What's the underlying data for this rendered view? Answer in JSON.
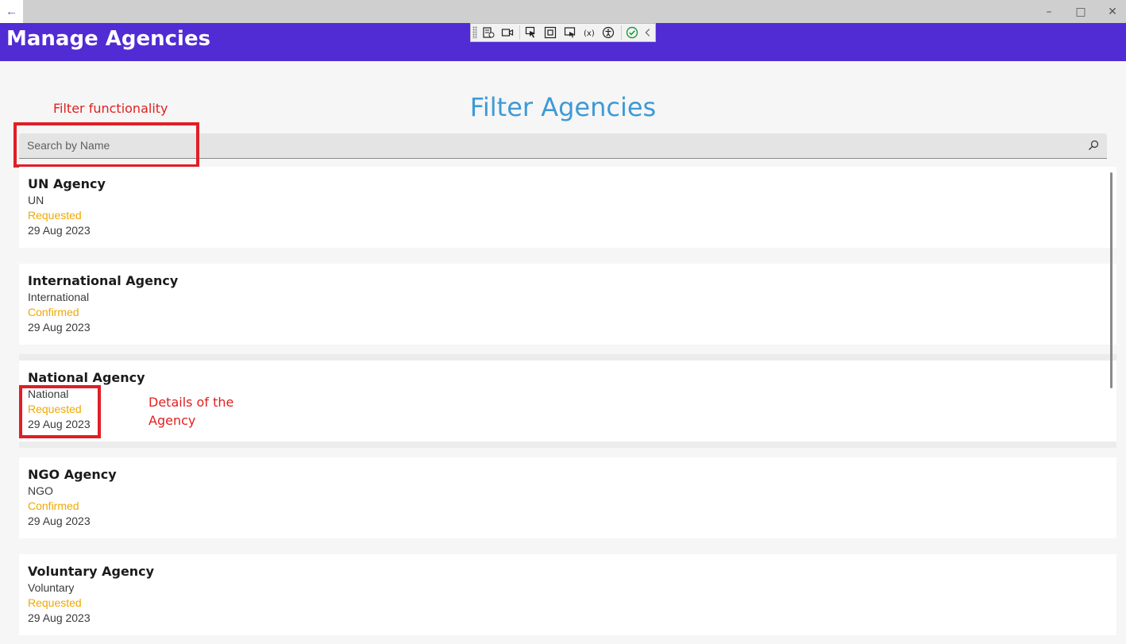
{
  "window": {
    "back_icon": "arrow-left-icon",
    "controls": [
      "minimize-icon",
      "maximize-icon",
      "close-icon"
    ]
  },
  "header": {
    "title": "Manage Agencies",
    "accent_color": "#512bd4"
  },
  "debug_toolbar": {
    "icons": [
      "live-visual-tree-icon",
      "record-icon",
      "select-element-icon",
      "display-layout-adorners-icon",
      "track-focus-icon",
      "binding-failures-icon",
      "accessibility-icon",
      "checkmark-icon",
      "collapse-chevron-icon"
    ]
  },
  "main": {
    "heading": "Filter Agencies",
    "search": {
      "placeholder": "Search by Name",
      "value": ""
    }
  },
  "annotations": {
    "filter_label": "Filter functionality",
    "details_label_line1": "Details of the",
    "details_label_line2": "Agency"
  },
  "agencies": [
    {
      "name": "UN Agency",
      "type": "UN",
      "status": "Requested",
      "date": "29 Aug 2023"
    },
    {
      "name": "International Agency",
      "type": "International",
      "status": "Confirmed",
      "date": "29 Aug 2023"
    },
    {
      "name": "National Agency",
      "type": "National",
      "status": "Requested",
      "date": "29 Aug 2023"
    },
    {
      "name": "NGO Agency",
      "type": "NGO",
      "status": "Confirmed",
      "date": "29 Aug 2023"
    },
    {
      "name": "Voluntary Agency",
      "type": "Voluntary",
      "status": "Requested",
      "date": "29 Aug 2023"
    }
  ],
  "colors": {
    "status": "#f0a800",
    "heading": "#3e9ad6",
    "annotation": "#e02020"
  }
}
